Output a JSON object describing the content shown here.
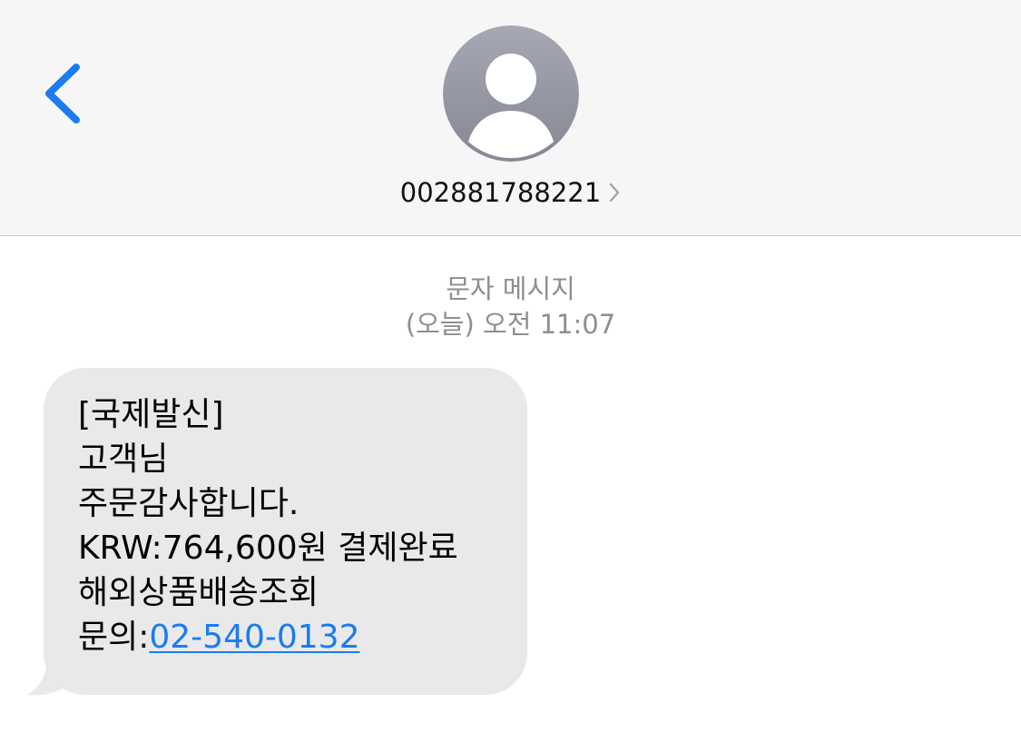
{
  "header": {
    "contact_number": "002881788221",
    "colors": {
      "accent": "#1a7cf0",
      "avatar": "#8e8e93"
    },
    "icons": {
      "back": "chevron-left-icon",
      "avatar": "person-silhouette-icon",
      "details": "chevron-right-icon"
    }
  },
  "conversation": {
    "message_type": "문자 메시지",
    "timestamp": "(오늘) 오전 11:07",
    "message": {
      "line1": "[국제발신]",
      "line2": "고객님",
      "line3": "주문감사합니다.",
      "line4": "KRW:764,600원 결제완료",
      "line5": "해외상품배송조회",
      "line6_prefix": "문의:",
      "line6_phone": "02-540-0132"
    },
    "colors": {
      "bubble": "#e9e9eb",
      "link": "#1a7cf0"
    }
  }
}
